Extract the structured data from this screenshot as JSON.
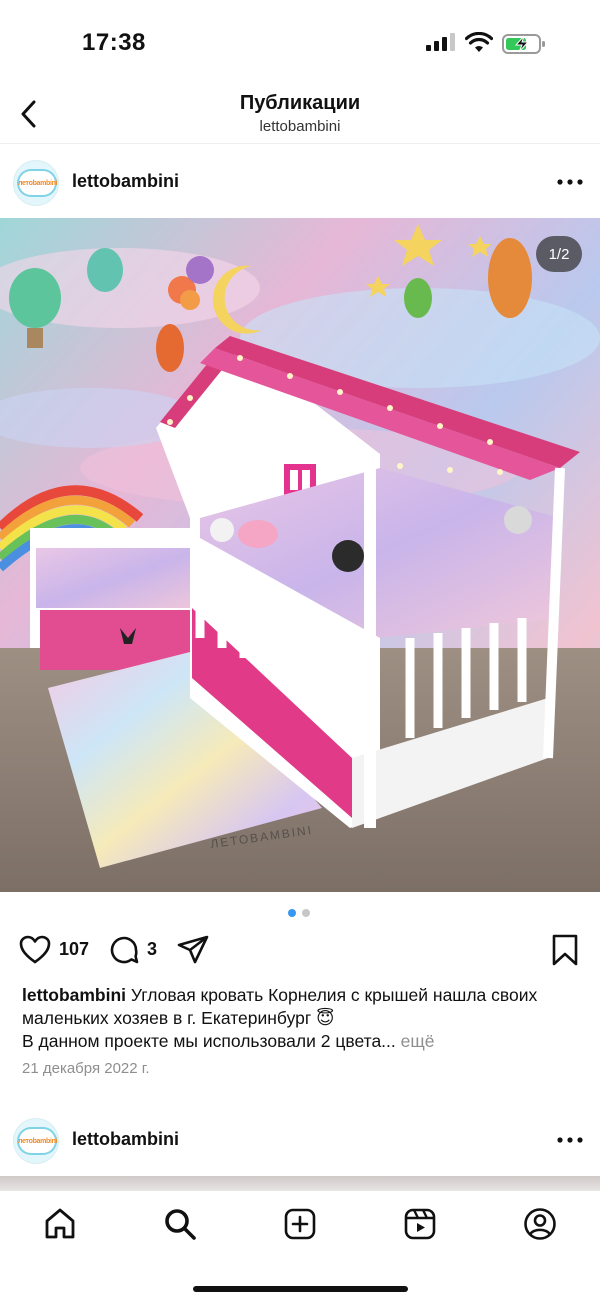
{
  "status_bar": {
    "time": "17:38"
  },
  "header": {
    "title": "Публикации",
    "subtitle": "lettobambini"
  },
  "avatar_logo_text": "летоbambini",
  "posts": [
    {
      "username": "lettobambini",
      "image_counter": "1/2",
      "image_watermark": "ЛЕТОBAMBINI",
      "likes": "107",
      "comments": "3",
      "caption": {
        "username": "lettobambini",
        "line1": "Угловая кровать Корнелия с крышей нашла своих маленьких хозяев в г. Екатеринбург 😇",
        "line2": "В данном проекте мы использовали 2 цвета...",
        "more": "ещё"
      },
      "date": "21 декабря 2022 г."
    },
    {
      "username": "lettobambini"
    }
  ],
  "carousel": {
    "total": 2,
    "active": 1,
    "active_color": "#3897f0",
    "inactive_color": "#c7c7c7"
  },
  "tabs": [
    "home-icon",
    "search-icon",
    "new-post-icon",
    "reels-icon",
    "profile-icon"
  ]
}
